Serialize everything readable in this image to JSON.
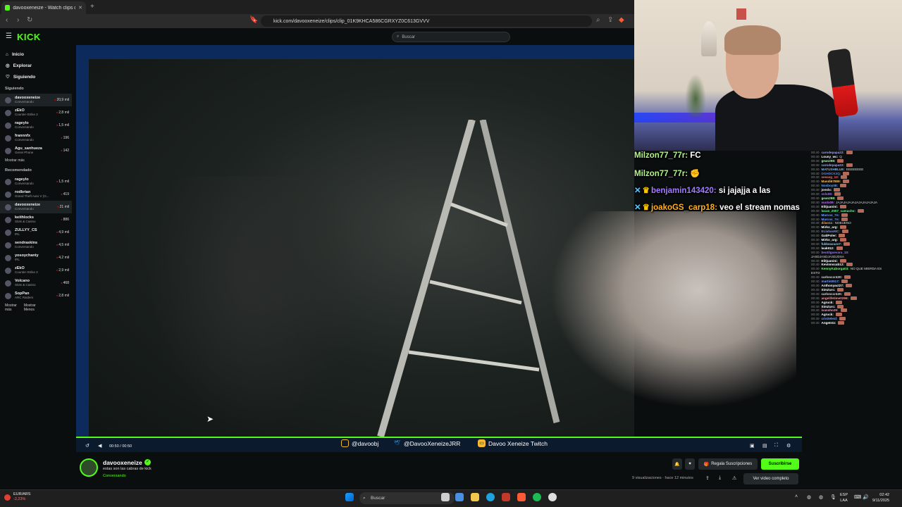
{
  "browser": {
    "tab_title": "davooxeneize - Watch clips on K",
    "url": "kick.com/davooxeneize/clips/clip_01K9KHCA586CGRXYZ0C613GVVV"
  },
  "kick": {
    "logo": "KICK",
    "search_placeholder": "Buscar",
    "nav": [
      {
        "label": "Inicio",
        "icon": "home-icon"
      },
      {
        "label": "Explorar",
        "icon": "compass-icon"
      },
      {
        "label": "Siguiendo",
        "icon": "heart-icon"
      }
    ],
    "following_header": "Siguiendo",
    "following": [
      {
        "name": "davooxeneize",
        "category": "Conversando",
        "viewers": "20,9 mil"
      },
      {
        "name": "zEkO",
        "category": "Counter-Strike 2",
        "viewers": "2,8 mil"
      },
      {
        "name": "rageylo",
        "category": "Conversando",
        "viewers": "1,5 mil"
      },
      {
        "name": "frannnfx",
        "category": "Conversando",
        "viewers": "196"
      },
      {
        "name": "Agu_sanhueza",
        "category": "Genie Phone",
        "viewers": "142"
      }
    ],
    "following_more": "Mostrar más",
    "recommended_header": "Recomendado",
    "recommended": [
      {
        "name": "rageylo",
        "category": "Conversando",
        "viewers": "1,5 mil"
      },
      {
        "name": "rodbrian",
        "category": "Grand Theft Auto V (G...",
        "viewers": "419"
      },
      {
        "name": "davooxeneize",
        "category": "Conversando",
        "viewers": "21 mil"
      },
      {
        "name": "keithlocks",
        "category": "Slots & Casino",
        "viewers": "886"
      },
      {
        "name": "ZULLYY_CS",
        "category": "IRL",
        "viewers": "4,9 mil"
      },
      {
        "name": "sendraskins",
        "category": "Conversando",
        "viewers": "4,5 mil"
      },
      {
        "name": "yosoychanty",
        "category": "IRL",
        "viewers": "4,2 mil"
      },
      {
        "name": "zEkO",
        "category": "Counter-Strike 2",
        "viewers": "2,9 mil"
      },
      {
        "name": "Volcano",
        "category": "Slots & Casino",
        "viewers": "468"
      },
      {
        "name": "SopPan",
        "category": "ARC Raiders",
        "viewers": "2,8 mil"
      }
    ],
    "recommended_more": "Mostrar más",
    "recommended_less": "Mostrar Menos",
    "player": {
      "time": "00:50 / 00:50",
      "socials": [
        {
          "label": "@davoobj",
          "icon": "instagram-icon",
          "color": "#f5b82e"
        },
        {
          "label": "@DavooXeneizeJRR",
          "icon": "twitter-icon",
          "color": "#1d9bf0"
        },
        {
          "label": "Davoo Xeneize Twitch",
          "icon": "twitch-icon",
          "color": "#f5b82e"
        }
      ]
    },
    "clip": {
      "channel": "davooxeneize",
      "title": "estas son las cabras de kick",
      "category": "Conversando",
      "views": "9 visualizaciones · hace 12 minutos",
      "gift_label": "Regala Suscripciones",
      "subscribe_label": "Suscribirse",
      "full_video_label": "Ver video completo"
    }
  },
  "overlay_chat": [
    {
      "user": "Milzon77_77r:",
      "text": "FC",
      "color": "#b2f58c",
      "badges": ""
    },
    {
      "user": "Milzon77_77r:",
      "text": "✊",
      "color": "#b2f58c",
      "badges": ""
    },
    {
      "user": "benjamin143420:",
      "text": "si jajajja a las",
      "color": "#a37bff",
      "badges": "✕♛"
    },
    {
      "user": "joakoGS_carp18:",
      "text": "veo el stream nomas",
      "color": "#ffb020",
      "badges": "✕♛"
    }
  ],
  "chat": [
    {
      "time": "00:40",
      "user": "carodepapa22:",
      "text": "",
      "color": "#a0a0ff",
      "emote": true
    },
    {
      "time": "00:40",
      "user": "Lousy_wc:",
      "text": "Q",
      "color": "#ffffff",
      "emote": false
    },
    {
      "time": "00:40",
      "user": "gean298:",
      "text": "",
      "color": "#a0ffa0",
      "emote": true
    },
    {
      "time": "00:40",
      "user": "carodepapa22:",
      "text": "",
      "color": "#a0a0ff",
      "emote": true
    },
    {
      "time": "00:40",
      "user": "MATUSHBLUE:",
      "text": "EEEEEEEE",
      "color": "#7fb0ff",
      "emote": false
    },
    {
      "time": "00:40",
      "user": "DGHDCK3Q:",
      "text": "",
      "color": "#4f7fff",
      "emote": true
    },
    {
      "time": "00:40",
      "user": "seeasg_12:",
      "text": "",
      "color": "#ff6f6f",
      "emote": true
    },
    {
      "time": "00:40",
      "user": "Mandi67889:",
      "text": "",
      "color": "#ffc060",
      "emote": true
    },
    {
      "time": "00:40",
      "user": "Nosboy08:",
      "text": "",
      "color": "#60a0ff",
      "emote": true
    },
    {
      "time": "00:40",
      "user": "jonslx:",
      "text": "",
      "color": "#ffffff",
      "emote": true
    },
    {
      "time": "00:40",
      "user": "svlo09:",
      "text": "",
      "color": "#a070ff",
      "emote": true
    },
    {
      "time": "00:40",
      "user": "gean298:",
      "text": "",
      "color": "#a0ffa0",
      "emote": true
    },
    {
      "time": "00:40",
      "user": "vuolx09:",
      "text": "JAJAJAJAJAJAJAJAJAJAJA",
      "color": "#c070ff",
      "emote": false
    },
    {
      "time": "00:40",
      "user": "Elitjuanini:",
      "text": "",
      "color": "#ffffff",
      "emote": true
    },
    {
      "time": "00:40",
      "user": "lucas_2007_camacho:",
      "text": "",
      "color": "#60ff90",
      "emote": true
    },
    {
      "time": "00:40",
      "user": "Marcos_7n:",
      "text": "",
      "color": "#6fa0ff",
      "emote": true
    },
    {
      "time": "00:40",
      "user": "Marcos_7n:",
      "text": "",
      "color": "#6fa0ff",
      "emote": true
    },
    {
      "time": "00:40",
      "user": "dilan11:",
      "text": "NOBUENO",
      "color": "#ff9f40",
      "emote": false
    },
    {
      "time": "00:40",
      "user": "Mirko_arg:",
      "text": "",
      "color": "#ffffff",
      "emote": true
    },
    {
      "time": "00:40",
      "user": "ELlahasMC:",
      "text": "",
      "color": "#7090ff",
      "emote": true
    },
    {
      "time": "00:40",
      "user": "GatiPoler:",
      "text": "",
      "color": "#ffffff",
      "emote": true
    },
    {
      "time": "00:40",
      "user": "Mirko_arg:",
      "text": "",
      "color": "#ffffff",
      "emote": true
    },
    {
      "time": "00:40",
      "user": "fukkeaxuzx7:",
      "text": "",
      "color": "#7fd0ff",
      "emote": true
    },
    {
      "time": "00:40",
      "user": "leak912:",
      "text": "",
      "color": "#ffffff",
      "emote": true
    },
    {
      "time": "00:40",
      "user": "beutilguevara_10:",
      "text": "",
      "color": "#a070ff",
      "emote": false
    },
    {
      "time": "",
      "user": "",
      "text": "JASDJASDJASDJDSA",
      "color": "#dddddd",
      "emote": false
    },
    {
      "time": "00:40",
      "user": "Elitjuanini:",
      "text": "",
      "color": "#ffffff",
      "emote": true
    },
    {
      "time": "00:40",
      "user": "Kevinnscab12:",
      "text": "",
      "color": "#ffffff",
      "emote": true
    },
    {
      "time": "00:40",
      "user": "KennyKaborga03:",
      "text": "NO QUE MIERDA ES",
      "color": "#70ff70",
      "emote": false
    },
    {
      "time": "",
      "user": "",
      "text": "ESTO",
      "color": "#dddddd",
      "emote": false
    },
    {
      "time": "00:40",
      "user": "carlosccr420:",
      "text": "",
      "color": "#dddddd",
      "emote": true
    },
    {
      "time": "00:40",
      "user": "martin0517:",
      "text": "",
      "color": "#70a0ff",
      "emote": true
    },
    {
      "time": "00:40",
      "user": "Anthonyact27:",
      "text": "",
      "color": "#ffffff",
      "emote": true
    },
    {
      "time": "00:40",
      "user": "SimZurc:",
      "text": "",
      "color": "#ffffff",
      "emote": true
    },
    {
      "time": "00:40",
      "user": "carlosccr420:",
      "text": "",
      "color": "#dddddd",
      "emote": true
    },
    {
      "time": "00:40",
      "user": "angelifetime0296:",
      "text": "",
      "color": "#ff9090",
      "emote": true
    },
    {
      "time": "00:40",
      "user": "Agruck:",
      "text": "",
      "color": "#ffffff",
      "emote": true
    },
    {
      "time": "00:40",
      "user": "SimZurc:",
      "text": "",
      "color": "#ffffff",
      "emote": true
    },
    {
      "time": "00:40",
      "user": "ivansho29:",
      "text": "",
      "color": "#ff8fbf",
      "emote": true
    },
    {
      "time": "00:40",
      "user": "Agruck:",
      "text": "",
      "color": "#ffffff",
      "emote": true
    },
    {
      "time": "00:40",
      "user": "crisiteleid:",
      "text": "",
      "color": "#70a0ff",
      "emote": true
    },
    {
      "time": "00:40",
      "user": "AngeIntz:",
      "text": "",
      "color": "#ffffff",
      "emote": true
    }
  ],
  "taskbar": {
    "ticker_label": "EUR/ARS",
    "ticker_change": "-2,23%",
    "search": "Buscar",
    "lang_top": "ESP",
    "lang_bottom": "LAA",
    "time": "02:42",
    "date": "9/11/2025"
  },
  "colors": {
    "kick_green": "#53fc18",
    "live_red": "#eb0400"
  }
}
